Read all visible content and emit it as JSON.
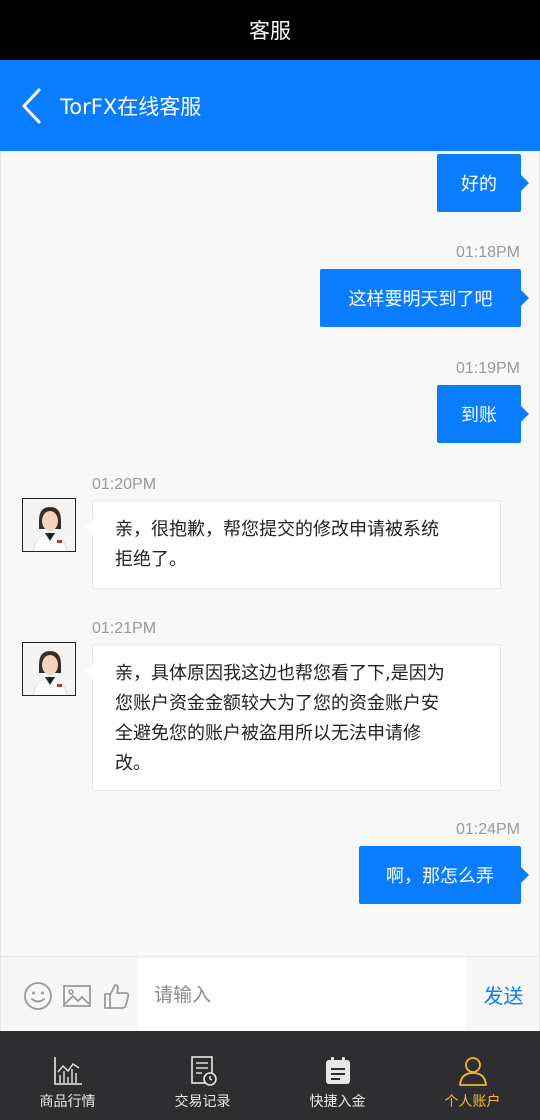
{
  "status_bar": {
    "title": "客服"
  },
  "nav": {
    "title": "TorFX在线客服",
    "back_icon": "chevron-left-icon"
  },
  "messages": [
    {
      "side": "out",
      "time": "",
      "text": "好的"
    },
    {
      "side": "out",
      "time": "01:18PM",
      "text": "这样要明天到了吧"
    },
    {
      "side": "out",
      "time": "01:19PM",
      "text": "到账"
    },
    {
      "side": "in",
      "time": "01:20PM",
      "lines": [
        "亲，很抱歉，帮您提交的修改申请被系统",
        "拒绝了。"
      ]
    },
    {
      "side": "in",
      "time": "01:21PM",
      "lines": [
        "亲，具体原因我这边也帮您看了下,是因为",
        "您账户资金金额较大为了您的资金账户安",
        "全避免您的账户被盗用所以无法申请修",
        "改。"
      ]
    },
    {
      "side": "out",
      "time": "01:24PM",
      "text": "啊，那怎么弄"
    }
  ],
  "input_bar": {
    "placeholder": "请输入",
    "value": "",
    "send_label": "发送",
    "icons": [
      "emoji-icon",
      "image-icon",
      "thumbs-up-icon"
    ]
  },
  "tabbar": {
    "tabs": [
      {
        "label": "商品行情",
        "icon": "chart-icon",
        "active": false
      },
      {
        "label": "交易记录",
        "icon": "record-clock-icon",
        "active": false
      },
      {
        "label": "快捷入金",
        "icon": "calendar-icon",
        "active": false
      },
      {
        "label": "个人账户",
        "icon": "person-icon",
        "active": true
      }
    ]
  },
  "colors": {
    "accent": "#0a7cff",
    "active_tab": "#f5b82c",
    "tabbar_bg": "#2e2e30"
  }
}
